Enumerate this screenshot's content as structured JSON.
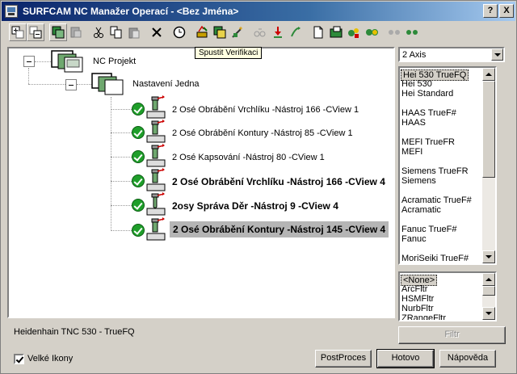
{
  "window": {
    "title": "SURFCAM NC Manažer Operací - <Bez Jména>",
    "help_label": "?",
    "close_label": "X"
  },
  "toolbar": {
    "tooltip": "Spustit Verifikaci",
    "icons": [
      "expand-all-icon",
      "collapse-all-icon",
      "copy-op-icon",
      "paste-op-icon",
      "cut-icon",
      "copy-icon",
      "paste-icon",
      "delete-icon",
      "clock-icon",
      "verify-icon",
      "copy-tool-icon",
      "wand-icon",
      "tool-link-icon",
      "red-arrow-icon",
      "green-arrow-icon",
      "blank-doc-icon",
      "green-folder-icon",
      "shapes-icon",
      "gears-icon",
      "dots-gray-icon",
      "dots-green-icon"
    ]
  },
  "tree": {
    "root": "NC Projekt",
    "setup": "Nastavení Jedna",
    "operations": [
      {
        "label": "2 Osé Obrábění Vrchlíku  -Nástroj 166 -CView 1",
        "bold": false,
        "selected": false
      },
      {
        "label": "2 Osé Obrábění Kontury  -Nástroj 85 -CView 1",
        "bold": false,
        "selected": false
      },
      {
        "label": "2 Osé Kapsování  -Nástroj 80 -CView 1",
        "bold": false,
        "selected": false
      },
      {
        "label": "2 Osé Obrábění Vrchlíku  -Nástroj 166 -CView 4",
        "bold": true,
        "selected": false
      },
      {
        "label": "2osy Správa Děr  -Nástroj 9 -CView 4",
        "bold": true,
        "selected": false
      },
      {
        "label": "2 Osé Obrábění Kontury  -Nástroj 145 -CView 4",
        "bold": true,
        "selected": true
      }
    ]
  },
  "post_panel": {
    "axis_select": "2 Axis",
    "post_list": [
      "Hei 530 TrueFQ",
      "Hei 530",
      "Hei Standard",
      "",
      "HAAS TrueF#",
      "HAAS",
      "",
      "MEFI TrueFR",
      "MEFI",
      "",
      "Siemens TrueFR",
      "Siemens",
      "",
      "Acramatic TrueF#",
      "Acramatic",
      "",
      "Fanuc TrueF#",
      "Fanuc",
      "",
      "MoriSeiki TrueF#"
    ],
    "selected_post": "Hei 530 TrueFQ",
    "filter_list": [
      "<None>",
      "ArcFltr",
      "HSMFltr",
      "NurbFltr",
      "ZRangeFltr"
    ],
    "selected_filter": "<None>",
    "filter_button": "Filtr"
  },
  "status_text": "Heidenhain TNC 530 - TrueFQ",
  "large_icons_label": "Velké Ikony",
  "large_icons_checked": true,
  "buttons": {
    "postproces": "PostProces",
    "done": "Hotovo",
    "help": "Nápověda"
  },
  "colors": {
    "titlebar": "#0a246a",
    "check_green": "#1f9e2a",
    "selection_gray": "#b5b5b5"
  }
}
